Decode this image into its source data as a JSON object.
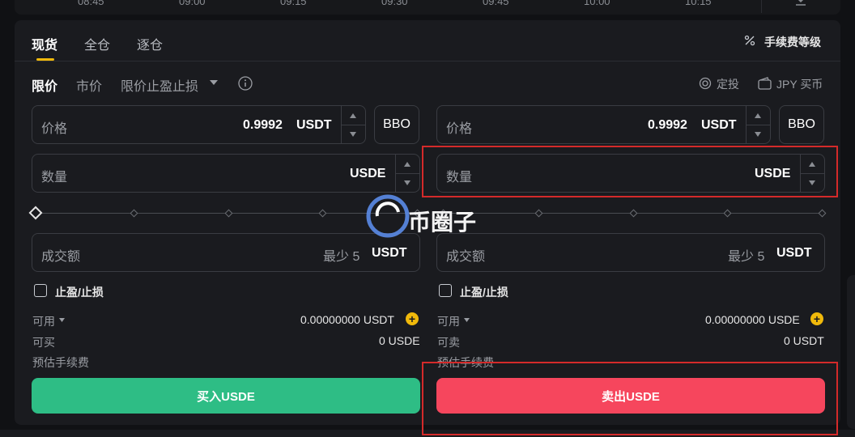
{
  "chart": {
    "times": [
      "08:45",
      "09:00",
      "09:15",
      "09:30",
      "09:45",
      "10:00",
      "10:15"
    ]
  },
  "tabs": {
    "spot": "现货",
    "cross": "全仓",
    "isolated": "逐仓"
  },
  "fee_level": "手续费等级",
  "order_types": {
    "limit": "限价",
    "market": "市价",
    "tpsl": "限价止盈止损"
  },
  "links": {
    "fixed_invest": "定投",
    "jpy_buy": "JPY 买币"
  },
  "buy": {
    "price_label": "价格",
    "price_value": "0.9992",
    "price_unit": "USDT",
    "bbo": "BBO",
    "qty_label": "数量",
    "qty_unit": "USDE",
    "amount_label": "成交额",
    "amount_min": "最少 5",
    "amount_unit": "USDT",
    "tpsl_label": "止盈/止损",
    "available_label": "可用",
    "available_value": "0.00000000 USDT",
    "can_buy_label": "可买",
    "can_buy_value": "0 USDE",
    "fee_label": "预估手续费",
    "button": "买入USDE"
  },
  "sell": {
    "price_label": "价格",
    "price_value": "0.9992",
    "price_unit": "USDT",
    "bbo": "BBO",
    "qty_label": "数量",
    "qty_unit": "USDE",
    "amount_label": "成交额",
    "amount_min": "最少 5",
    "amount_unit": "USDT",
    "tpsl_label": "止盈/止损",
    "available_label": "可用",
    "available_value": "0.00000000 USDE",
    "can_sell_label": "可卖",
    "can_sell_value": "0 USDT",
    "fee_label": "预估手续费",
    "button": "卖出USDE"
  },
  "watermark": "币圈子",
  "colors": {
    "accent": "#f0b90b",
    "buy": "#2ebd85",
    "sell": "#f6465d",
    "highlight": "#d42a2a"
  }
}
